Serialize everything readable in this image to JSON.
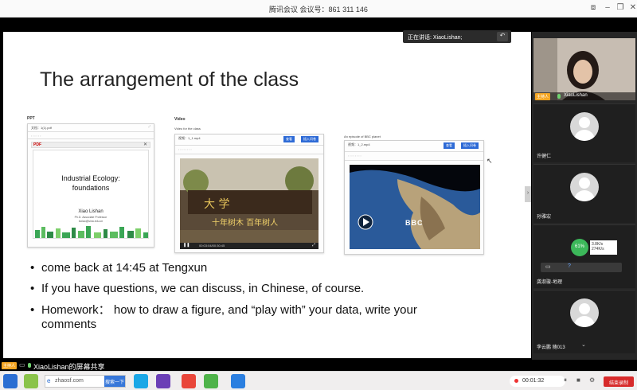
{
  "window": {
    "title": "腾讯会议  会议号：861 311 146"
  },
  "speaking": {
    "label": "正在讲话: XiaoLishan;"
  },
  "slide": {
    "title": "The arrangement of the class",
    "ppt": {
      "label": "PPT",
      "file": "文档：1(1).pdf",
      "pdf_title_1": "Industrial  Ecology:",
      "pdf_title_2": "foundations",
      "pdf_author": "Xiao Lishan",
      "pdf_role": "Ph.D. Associate Professor",
      "pdf_email": "lsxiao@sina.edu.cn"
    },
    "video": {
      "label": "Video",
      "sub": "Video for the class",
      "file": "视频：1_1.mp4",
      "btn_view": "查看",
      "btn_add": "插入问卷",
      "time": "00:03:04/00:30:45"
    },
    "bbc": {
      "label": "An episode of BBC planet",
      "file": "视频：1_2.mp4",
      "btn_view": "查看",
      "btn_add": "插入问卷",
      "logo": "BBC"
    },
    "bullets": [
      "come back at 14:45 at Tengxun",
      "If you have questions, we can discuss, in Chinese, of course.",
      "Homework： how to draw a figure, and “play with” your data, write your",
      "comments"
    ]
  },
  "participants": [
    {
      "name": "XiaoLishan",
      "role": "主持人"
    },
    {
      "name": "许健仁"
    },
    {
      "name": "孙雅宏"
    },
    {
      "name": "龚淑璇-地理"
    },
    {
      "name": "李云鹏 随013"
    }
  ],
  "net": {
    "cpu": "61%",
    "up": "3.8K/s",
    "down": "274K/s"
  },
  "sharebar": {
    "host": "主持人",
    "text": "XiaoLishan的屏幕共享"
  },
  "taskbar": {
    "search_text": "zhaosf.com",
    "search_btn": "搜索一下",
    "timer": "00:01:32",
    "record_btn": "结束录制"
  }
}
